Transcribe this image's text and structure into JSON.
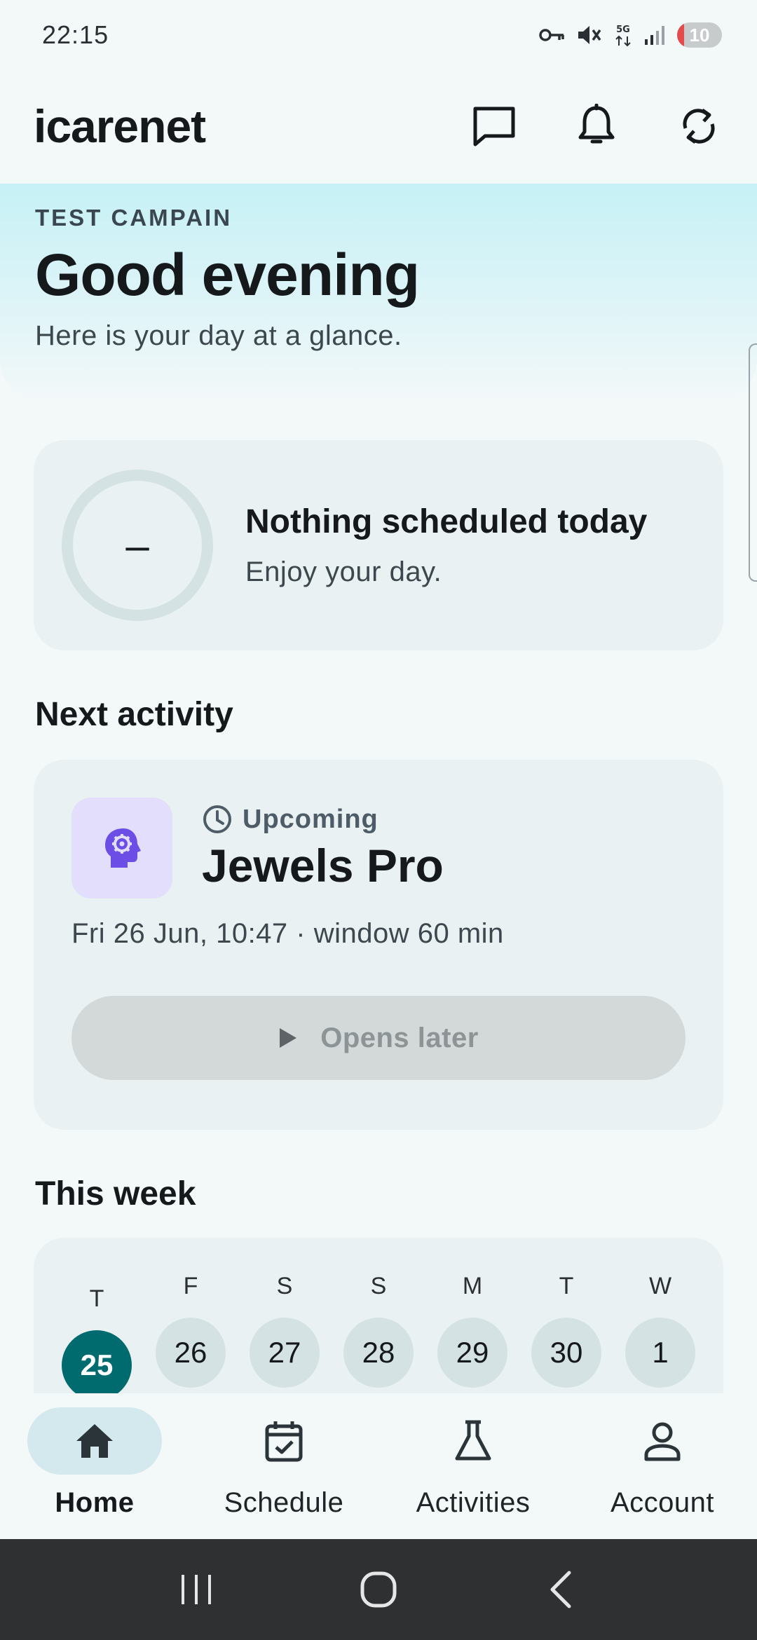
{
  "status_bar": {
    "time": "22:15",
    "network_label": "5G",
    "battery": "10",
    "icons": [
      "vpn-key-icon",
      "mute-icon",
      "5g-icon",
      "signal-icon",
      "battery-icon"
    ]
  },
  "app_bar": {
    "title": "icarenet",
    "actions": [
      "messages-icon",
      "notifications-bell-icon",
      "sync-icon"
    ]
  },
  "hero": {
    "eyebrow": "TEST CAMPAIN",
    "greeting": "Good evening",
    "subtitle": "Here is your day at a glance."
  },
  "today": {
    "ring_value": "–",
    "title": "Nothing scheduled today",
    "subtitle": "Enjoy your day."
  },
  "next_activity": {
    "section_title": "Next activity",
    "status": "Upcoming",
    "name": "Jewels Pro",
    "time": "Fri 26 Jun, 10:47 · window 60 min",
    "button_label": "Opens later",
    "icon": "brain-gear-icon"
  },
  "week": {
    "section_title": "This week",
    "days": [
      {
        "letter": "T",
        "num": "25",
        "today": true
      },
      {
        "letter": "F",
        "num": "26"
      },
      {
        "letter": "S",
        "num": "27"
      },
      {
        "letter": "S",
        "num": "28"
      },
      {
        "letter": "M",
        "num": "29"
      },
      {
        "letter": "T",
        "num": "30"
      },
      {
        "letter": "W",
        "num": "1"
      }
    ]
  },
  "bottom_nav": {
    "items": [
      {
        "label": "Home",
        "icon": "home-icon",
        "active": true
      },
      {
        "label": "Schedule",
        "icon": "calendar-check-icon"
      },
      {
        "label": "Activities",
        "icon": "flask-icon"
      },
      {
        "label": "Account",
        "icon": "person-icon"
      }
    ]
  },
  "colors": {
    "accent": "#006b6e",
    "hero_gradient_top": "#c6f1f6",
    "activity_tile": "#e2defc",
    "activity_icon": "#6c4ee6"
  }
}
